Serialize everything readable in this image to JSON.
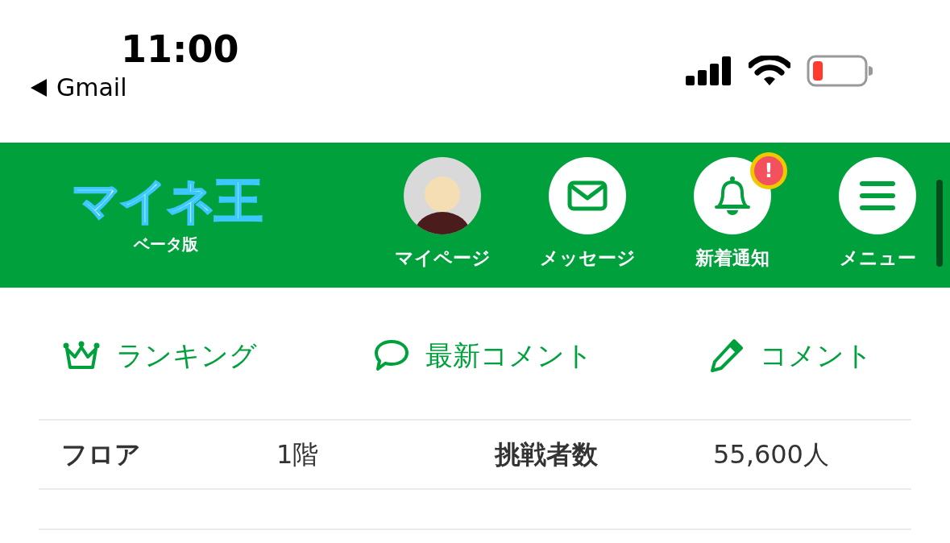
{
  "status_bar": {
    "time": "11:00",
    "back_label": "Gmail"
  },
  "header": {
    "logo": "マイネ王",
    "logo_subtitle": "ベータ版",
    "nav": [
      {
        "kind": "avatar",
        "label": "マイページ"
      },
      {
        "kind": "mail",
        "label": "メッセージ"
      },
      {
        "kind": "bell",
        "label": "新着通知",
        "badge": "!"
      },
      {
        "kind": "menu",
        "label": "メニュー"
      }
    ]
  },
  "actions": [
    {
      "kind": "crown",
      "label": "ランキング"
    },
    {
      "kind": "chat",
      "label": "最新コメント"
    },
    {
      "kind": "pencil",
      "label": "コメント"
    }
  ],
  "info_table": {
    "rows": [
      {
        "cells": [
          "フロア",
          "1階",
          "挑戦者数",
          "55,600人"
        ]
      }
    ]
  }
}
